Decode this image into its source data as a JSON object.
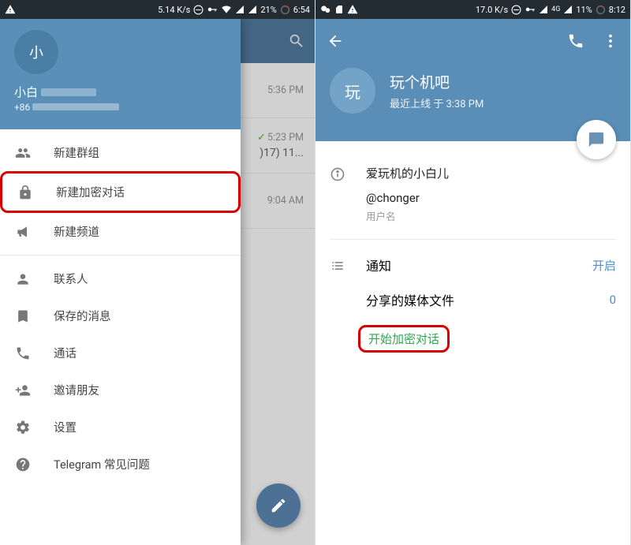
{
  "left": {
    "status": {
      "speed": "5.14 K/s",
      "battery": "21%",
      "time": "6:54"
    },
    "drawer": {
      "avatar_letter": "小",
      "name_prefix": "小白",
      "phone_prefix": "+86",
      "items": {
        "new_group": "新建群组",
        "new_secret": "新建加密对话",
        "new_channel": "新建频道",
        "contacts": "联系人",
        "saved": "保存的消息",
        "calls": "通话",
        "invite": "邀请朋友",
        "settings": "设置",
        "faq": "Telegram 常见问题"
      }
    },
    "chats": {
      "r1_time": "5:36 PM",
      "r2_time": "5:23 PM",
      "r2_text": ")17) 11...",
      "r3_time": "9:04 AM"
    }
  },
  "right": {
    "status": {
      "speed": "17.0 K/s",
      "net": "4G",
      "battery": "11%",
      "time": "8:12"
    },
    "profile": {
      "avatar_letter": "玩",
      "name": "玩个机吧",
      "last_seen": "最近上线 于 3:38 PM",
      "info_title": "爱玩机的小白儿",
      "username": "@chonger",
      "username_caption": "用户名",
      "notifications_label": "通知",
      "notifications_value": "开启",
      "shared_media_label": "分享的媒体文件",
      "shared_media_value": "0",
      "start_secret": "开始加密对话"
    }
  }
}
